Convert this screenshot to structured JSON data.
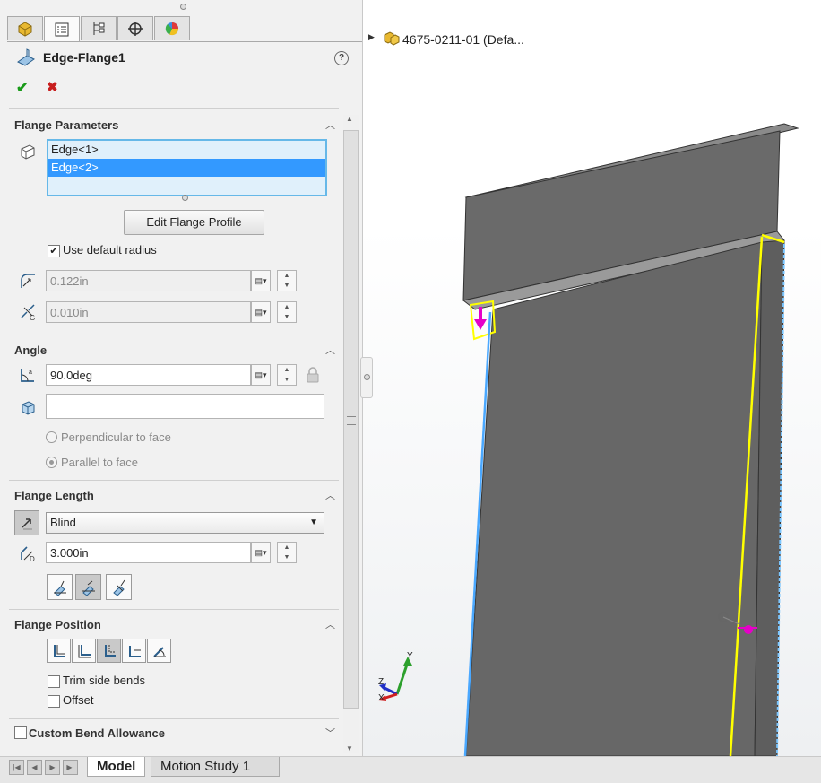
{
  "property_manager": {
    "tabs": [
      {
        "name": "feature-manager-tab",
        "icon": "part-icon"
      },
      {
        "name": "property-manager-tab",
        "icon": "property-list-icon"
      },
      {
        "name": "configuration-manager-tab",
        "icon": "configuration-icon"
      },
      {
        "name": "dimxpert-tab",
        "icon": "crosshair-icon"
      },
      {
        "name": "display-manager-tab",
        "icon": "appearance-pie-icon"
      }
    ],
    "title": "Edge-Flange1",
    "help_label": "?",
    "ok_label": "✔",
    "cancel_label": "✖",
    "flange_parameters": {
      "title": "Flange Parameters",
      "edges": [
        "Edge<1>",
        "Edge<2>"
      ],
      "selected_edge": "Edge<2>",
      "edit_profile_label": "Edit Flange Profile",
      "use_default_radius_label": "Use default radius",
      "use_default_radius_checked": true,
      "radius_value": "0.122in",
      "gap_value": "0.010in"
    },
    "angle": {
      "title": "Angle",
      "value": "90.0deg",
      "face_value": "",
      "perpendicular_label": "Perpendicular to face",
      "parallel_label": "Parallel to face"
    },
    "flange_length": {
      "title": "Flange Length",
      "end_condition": "Blind",
      "value": "3.000in"
    },
    "flange_position": {
      "title": "Flange Position",
      "trim_side_bends_label": "Trim side bends",
      "offset_label": "Offset"
    },
    "custom_bend_allowance": {
      "title": "Custom Bend Allowance"
    }
  },
  "viewport": {
    "tree_item_label": "4675-0211-01  (Defa...",
    "triad": {
      "x": "X",
      "y": "Y",
      "z": "Z"
    }
  },
  "bottom_bar": {
    "tabs": [
      "Model",
      "Motion Study 1"
    ],
    "active_tab": "Model"
  },
  "colors": {
    "selection_blue": "#3399ff",
    "listbox_border": "#66b8e8",
    "highlight_yellow": "#ffff00",
    "part_gray": "#676767",
    "arrow_magenta": "#e600c8"
  }
}
